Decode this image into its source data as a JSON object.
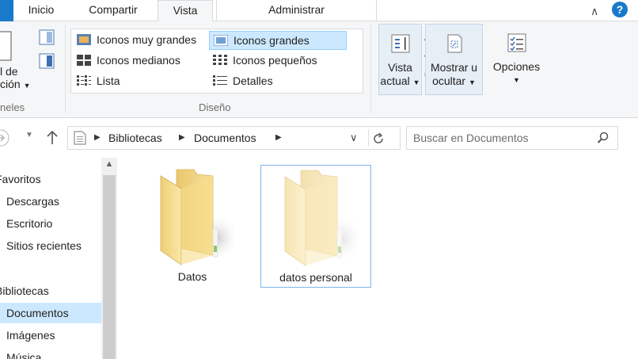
{
  "ribbon_tabs": {
    "inicio": "Inicio",
    "compartir": "Compartir",
    "vista": "Vista",
    "administrar": "Administrar"
  },
  "ribbon": {
    "panes_label_partial_1": "l de",
    "panes_label_partial_2": "ción",
    "panes_group_partial": "neles",
    "layout": {
      "items": [
        {
          "label": "Iconos muy grandes"
        },
        {
          "label": "Iconos grandes"
        },
        {
          "label": "Iconos medianos"
        },
        {
          "label": "Iconos pequeños"
        },
        {
          "label": "Lista"
        },
        {
          "label": "Detalles"
        }
      ],
      "selected": "Iconos grandes",
      "group_label": "Diseño"
    },
    "vista_actual": {
      "line1": "Vista",
      "line2": "actual"
    },
    "mostrar_ocultar": {
      "line1": "Mostrar u",
      "line2": "ocultar"
    },
    "opciones": {
      "label": "Opciones"
    }
  },
  "address": {
    "crumbs": [
      "Bibliotecas",
      "Documentos"
    ]
  },
  "search": {
    "placeholder": "Buscar en Documentos"
  },
  "nav_pane": {
    "items": [
      {
        "label": "Favoritos",
        "type": "header"
      },
      {
        "label": "Descargas",
        "type": "item"
      },
      {
        "label": "Escritorio",
        "type": "item"
      },
      {
        "label": "Sitios recientes",
        "type": "item"
      },
      {
        "label": "Bibliotecas",
        "type": "header"
      },
      {
        "label": "Documentos",
        "type": "item",
        "selected": true
      },
      {
        "label": "Imágenes",
        "type": "item"
      },
      {
        "label": "Música",
        "type": "item"
      }
    ]
  },
  "content": {
    "folders": [
      {
        "name": "Datos",
        "selected": false
      },
      {
        "name": "datos personal",
        "selected": true
      }
    ]
  },
  "colors": {
    "accent": "#1979ca",
    "selection_fill": "#cce8ff",
    "selection_border": "#7eb4ea",
    "folder": "#f3d98a"
  }
}
